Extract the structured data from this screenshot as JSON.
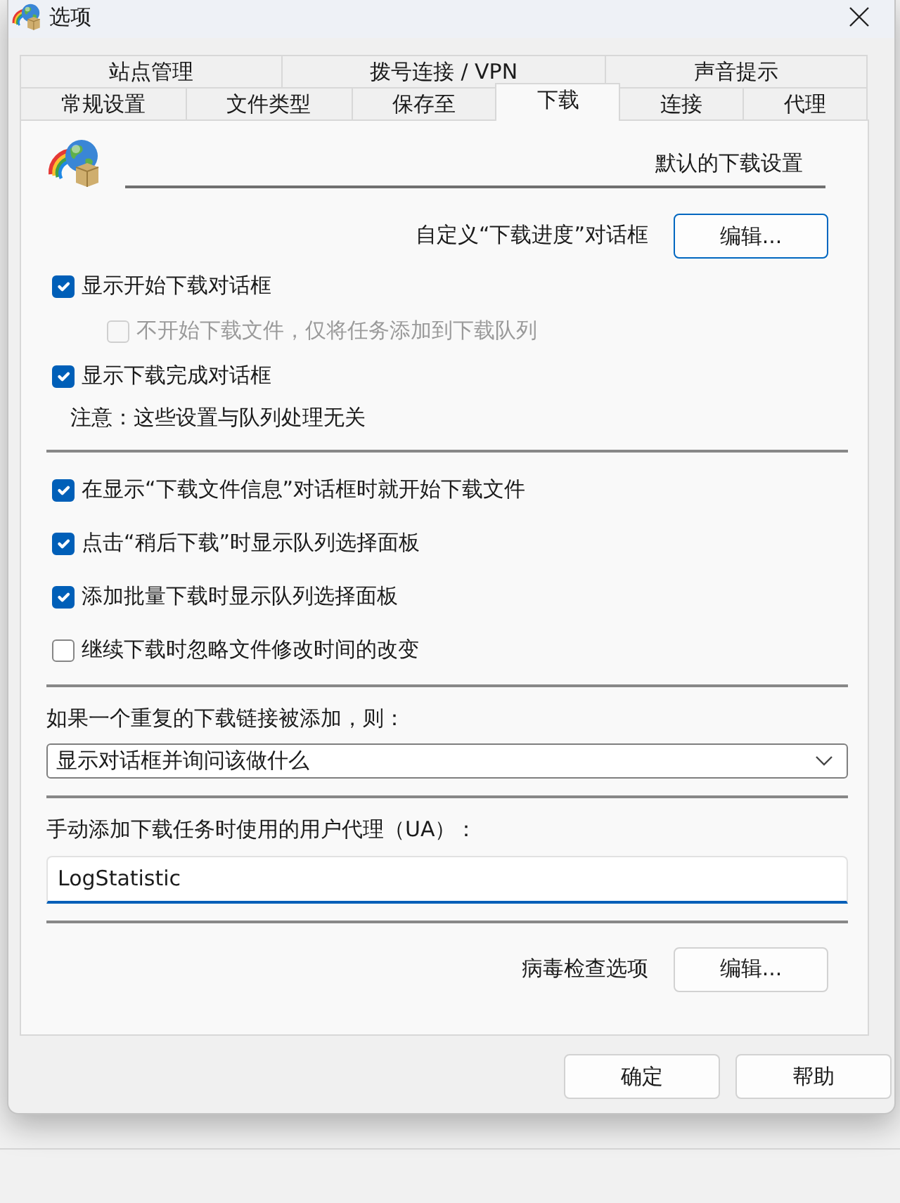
{
  "window": {
    "title": "选项"
  },
  "tab_rows": [
    {
      "tabs": [
        {
          "label": "站点管理",
          "selected": false
        },
        {
          "label": "拨号连接 / VPN",
          "selected": false
        },
        {
          "label": "声音提示",
          "selected": false
        }
      ]
    },
    {
      "tabs": [
        {
          "label": "常规设置",
          "selected": false
        },
        {
          "label": "文件类型",
          "selected": false
        },
        {
          "label": "保存至",
          "selected": false
        },
        {
          "label": "下载",
          "selected": true
        },
        {
          "label": "连接",
          "selected": false
        },
        {
          "label": "代理",
          "selected": false
        }
      ]
    }
  ],
  "panel": {
    "heading": "默认的下载设置",
    "sections": [
      {
        "items": [
          {
            "kind": "button_row",
            "label": "自定义“下载进度”对话框",
            "button": {
              "label": "编辑...",
              "focused": true
            }
          },
          {
            "kind": "checkbox",
            "label": "显示开始下载对话框",
            "checked": true,
            "disabled": false,
            "children": [
              {
                "kind": "checkbox",
                "label": "不开始下载文件，仅将任务添加到下载队列",
                "checked": false,
                "disabled": true
              }
            ]
          },
          {
            "kind": "checkbox",
            "label": "显示下载完成对话框",
            "checked": true,
            "disabled": false
          },
          {
            "kind": "note",
            "text": "注意：这些设置与队列处理无关"
          }
        ]
      },
      {
        "items": [
          {
            "kind": "checkbox",
            "label": "在显示“下载文件信息”对话框时就开始下载文件",
            "checked": true,
            "disabled": false
          },
          {
            "kind": "checkbox",
            "label": "点击“稍后下载”时显示队列选择面板",
            "checked": true,
            "disabled": false
          },
          {
            "kind": "checkbox",
            "label": "添加批量下载时显示队列选择面板",
            "checked": true,
            "disabled": false
          },
          {
            "kind": "checkbox",
            "label": "继续下载时忽略文件修改时间的改变",
            "checked": false,
            "disabled": false
          }
        ]
      },
      {
        "items": [
          {
            "kind": "label",
            "text": "如果一个重复的下载链接被添加，则："
          },
          {
            "kind": "dropdown",
            "value": "显示对话框并询问该做什么"
          }
        ]
      },
      {
        "items": [
          {
            "kind": "label",
            "text": "手动添加下载任务时使用的用户代理（UA）："
          },
          {
            "kind": "input",
            "value": "LogStatistic",
            "focused": true
          }
        ]
      },
      {
        "items": [
          {
            "kind": "button_row",
            "label": "病毒检查选项",
            "button": {
              "label": "编辑...",
              "focused": false
            }
          }
        ]
      }
    ]
  },
  "buttons": [
    "确定",
    "帮助"
  ]
}
